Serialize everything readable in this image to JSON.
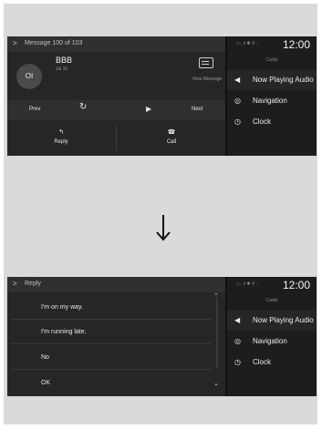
{
  "screen_before": {
    "header": {
      "chevron": ">",
      "title": "Message 100 of 103"
    },
    "message": {
      "avatar_initials": "OI",
      "sender": "BBB",
      "date": "Jul 31",
      "view_message_label": "View Message"
    },
    "controls": {
      "prev_label": "Prev",
      "next_label": "Next",
      "repeat_icon": "repeat-icon",
      "play_icon": "play-icon"
    },
    "actions": {
      "reply_label": "Reply",
      "call_label": "Call"
    },
    "status": {
      "icons": "▭ .ıl ✱ ⚲ ◦",
      "time": "12:00"
    },
    "cards": {
      "title": "Cards",
      "items": [
        {
          "label": "Now Playing Audio",
          "icon": "speaker-icon"
        },
        {
          "label": "Navigation",
          "icon": "navigation-icon"
        },
        {
          "label": "Clock",
          "icon": "clock-icon"
        }
      ]
    }
  },
  "screen_after": {
    "header": {
      "chevron": ">",
      "title": "Reply"
    },
    "replies": [
      {
        "label": "I'm on my way."
      },
      {
        "label": "I'm running late."
      },
      {
        "label": "No"
      },
      {
        "label": "OK"
      }
    ],
    "status": {
      "icons": "▭ .ıl ✱ ⚲ ◦",
      "time": "12:00"
    },
    "cards": {
      "title": "Cards",
      "items": [
        {
          "label": "Now Playing Audio",
          "icon": "speaker-icon"
        },
        {
          "label": "Navigation",
          "icon": "navigation-icon"
        },
        {
          "label": "Clock",
          "icon": "clock-icon"
        }
      ]
    }
  },
  "colors": {
    "screen_bg": "#202020",
    "page_bg": "#dadada",
    "text": "#f0f0f0"
  },
  "arrow_icon": "arrow-down-icon"
}
